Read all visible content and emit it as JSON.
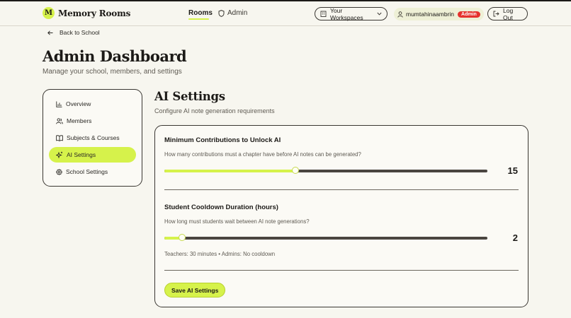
{
  "brand": {
    "mark": "M",
    "name": "Memory Rooms",
    "accent": "#d6f24b"
  },
  "nav": {
    "rooms": "Rooms",
    "admin": "Admin"
  },
  "workspaces": {
    "label": "Your Workspaces"
  },
  "user": {
    "name": "mumtahinaambrin",
    "role_badge": "Admin"
  },
  "logout": {
    "label": "Log Out"
  },
  "back": {
    "label": "Back to School"
  },
  "header": {
    "title": "Admin Dashboard",
    "subtitle": "Manage your school, members, and settings"
  },
  "sidebar": {
    "items": [
      {
        "label": "Overview",
        "icon": "bar-chart-icon",
        "active": false
      },
      {
        "label": "Members",
        "icon": "users-icon",
        "active": false
      },
      {
        "label": "Subjects & Courses",
        "icon": "book-icon",
        "active": false
      },
      {
        "label": "AI Settings",
        "icon": "sparkles-icon",
        "active": true
      },
      {
        "label": "School Settings",
        "icon": "gear-icon",
        "active": false
      }
    ]
  },
  "main": {
    "title": "AI Settings",
    "subtitle": "Configure AI note generation requirements",
    "min_contrib": {
      "title": "Minimum Contributions to Unlock AI",
      "desc": "How many contributions must a chapter have before AI notes can be generated?",
      "value": "15",
      "fill_fraction": 0.405
    },
    "cooldown": {
      "title": "Student Cooldown Duration (hours)",
      "desc": "How long must students wait between AI note generations?",
      "value": "2",
      "fill_fraction": 0.055,
      "note": "Teachers: 30 minutes • Admins: No cooldown"
    },
    "save_label": "Save AI Settings"
  }
}
